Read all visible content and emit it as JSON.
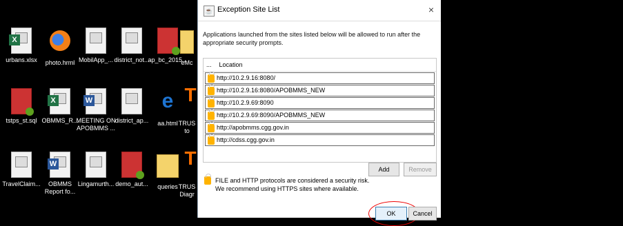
{
  "desktop": {
    "icons": [
      {
        "label": "urbans.xlsx",
        "type": "excel"
      },
      {
        "label": "photo.hrml",
        "type": "firefox"
      },
      {
        "label": "MobilApp_...",
        "type": "doc"
      },
      {
        "label": "district_not...",
        "type": "doc"
      },
      {
        "label": "ap_bc_2015...",
        "type": "jar"
      },
      {
        "label": "eMc",
        "type": "folder"
      },
      {
        "label": "tstps_st.sql",
        "type": "jar"
      },
      {
        "label": "OBMMS_R...",
        "type": "excel"
      },
      {
        "label": "MEETING ON APOBMMS ...",
        "type": "word"
      },
      {
        "label": "district_ap...",
        "type": "doc"
      },
      {
        "label": "aa.html",
        "type": "ie"
      },
      {
        "label": "TRUS to",
        "type": "trust"
      },
      {
        "label": "TravelClaim...",
        "type": "doc"
      },
      {
        "label": "OBMMS Report fo...",
        "type": "word"
      },
      {
        "label": "Lingamurth...",
        "type": "doc"
      },
      {
        "label": "demo_aut...",
        "type": "jar"
      },
      {
        "label": "queries",
        "type": "folder"
      },
      {
        "label": "TRUS Diagr",
        "type": "trust"
      }
    ]
  },
  "dialog": {
    "title": "Exception Site List",
    "close_icon": "×",
    "description": "Applications launched from the sites listed below will be allowed to run after the appropriate security prompts.",
    "list_header_dots": "...",
    "list_header_label": "Location",
    "sites": [
      "http://10.2.9.16:8080/",
      "http://10.2.9.16:8080/APOBMMS_NEW",
      "http://10.2.9.69:8090",
      "http://10.2.9.69:8090/APOBMMS_NEW",
      "http://apobmms.cgg.gov.in",
      "http://cdss.cgg.gov.in"
    ],
    "add_label": "Add",
    "remove_label": "Remove",
    "warning_line1": "FILE and HTTP protocols are considered a security risk.",
    "warning_line2": "We recommend using HTTPS sites where available.",
    "ok_label": "OK",
    "cancel_label": "Cancel"
  }
}
